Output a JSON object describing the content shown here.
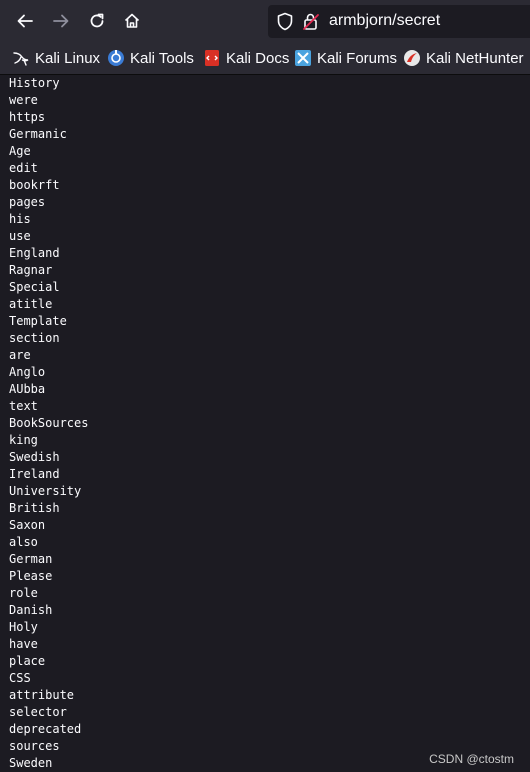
{
  "browser": {
    "url": "armbjorn/secret",
    "bookmarks": [
      {
        "label": "Kali Linux",
        "icon": "kali-dragon-icon"
      },
      {
        "label": "Kali Tools",
        "icon": "kali-tools-icon"
      },
      {
        "label": "Kali Docs",
        "icon": "kali-docs-icon"
      },
      {
        "label": "Kali Forums",
        "icon": "kali-forums-icon"
      },
      {
        "label": "Kali NetHunter",
        "icon": "kali-nethunter-icon"
      }
    ]
  },
  "page": {
    "words": [
      "History",
      "were",
      "https",
      "Germanic",
      "Age",
      "edit",
      "bookrft",
      "pages",
      "his",
      "use",
      "England",
      "Ragnar",
      "Special",
      "atitle",
      "Template",
      "section",
      "are",
      "Anglo",
      "AUbba",
      "text",
      "BookSources",
      "king",
      "Swedish",
      "Ireland",
      "University",
      "British",
      "Saxon",
      "also",
      "German",
      "Please",
      "role",
      "Danish",
      "Holy",
      "have",
      "place",
      "CSS",
      "attribute",
      "selector",
      "deprecated",
      "sources",
      "Sweden"
    ]
  },
  "watermark": "CSDN @ctostm",
  "colors": {
    "toolbar": "#2b2a33",
    "page_bg": "#1c1b22",
    "text": "#fbfbfe"
  }
}
